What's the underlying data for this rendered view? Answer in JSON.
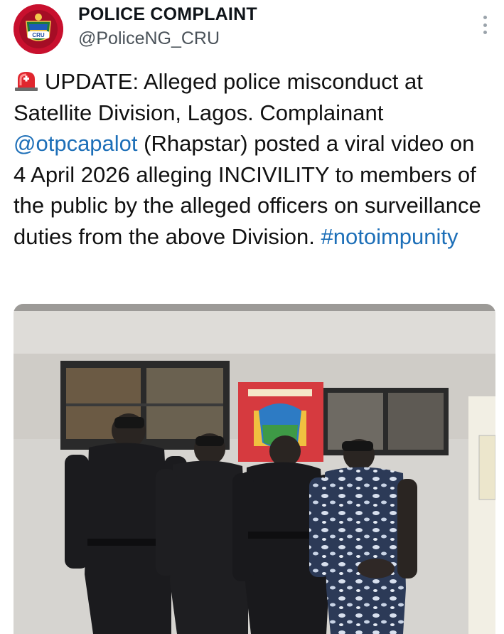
{
  "account": {
    "display_name": "POLICE COMPLAINT",
    "handle": "@PoliceNG_CRU",
    "avatar_badge_text": "CRU"
  },
  "icons": {
    "avatar": "police-badge-icon",
    "more": "more-vertical-icon",
    "siren": "police-light-icon"
  },
  "tweet": {
    "text_intro": "UPDATE: Alleged police misconduct at Satellite Division, Lagos. Complainant ",
    "mention": "@otpcapalot",
    "text_body": " (Rhapstar) posted a viral video on 4 April 2026 alleging INCIVILITY to members of the public by the alleged officers on surveillance duties from the above Division. ",
    "hashtag": "#notoimpunity"
  },
  "colors": {
    "link": "#1d6fb8",
    "name_text": "#0f1419",
    "handle_text": "#4a5259",
    "avatar_bg": "#c8102e"
  }
}
